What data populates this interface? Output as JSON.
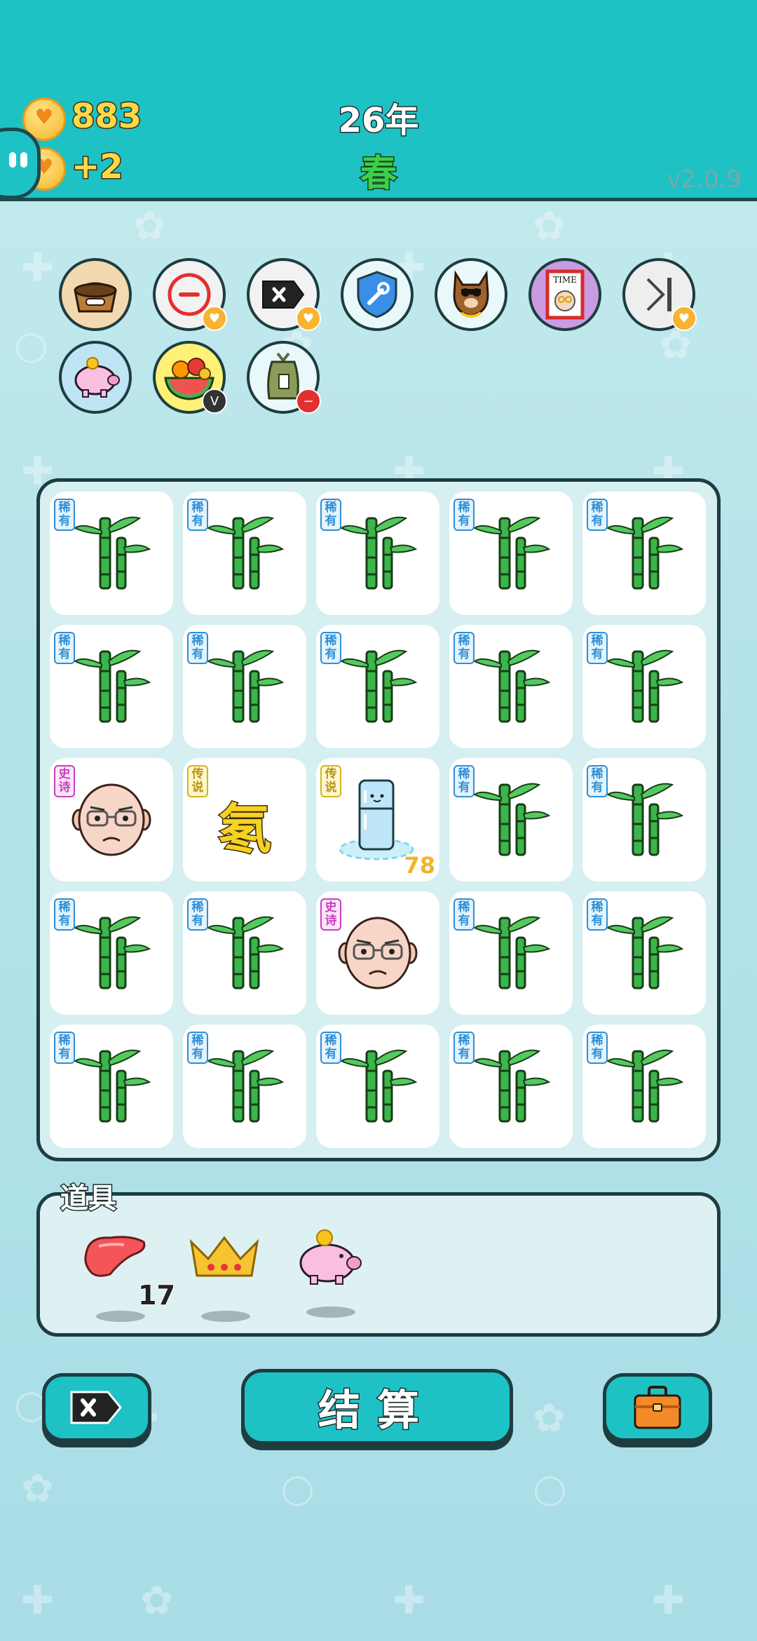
{
  "header": {
    "coins": "883",
    "income": "+2",
    "year": "26年",
    "season": "春",
    "version": "v2.0.9"
  },
  "relics": [
    {
      "icon": "pet-food-bowl-icon"
    },
    {
      "icon": "remove-minus-icon"
    },
    {
      "icon": "delete-tag-icon"
    },
    {
      "icon": "shield-wrench-icon"
    },
    {
      "icon": "cool-dog-icon"
    },
    {
      "icon": "time-magazine-icon"
    },
    {
      "icon": "skip-forward-icon"
    },
    {
      "icon": "piggy-bank-icon"
    },
    {
      "icon": "fruit-basket-icon"
    },
    {
      "icon": "trash-bag-icon"
    }
  ],
  "tags": {
    "rare": "稀有",
    "epic": "史诗",
    "legend": "传说"
  },
  "board": {
    "rows": [
      [
        "bamboo",
        "bamboo",
        "bamboo",
        "bamboo",
        "bamboo"
      ],
      [
        "bamboo",
        "bamboo",
        "bamboo",
        "bamboo",
        "bamboo"
      ],
      [
        "old-man",
        "radon",
        "fridge",
        "bamboo",
        "bamboo"
      ],
      [
        "bamboo",
        "bamboo",
        "old-man",
        "bamboo",
        "bamboo"
      ],
      [
        "bamboo",
        "bamboo",
        "bamboo",
        "bamboo",
        "bamboo"
      ]
    ],
    "radon_char": "氡",
    "fridge_count": "78"
  },
  "items_panel": {
    "title": "道具",
    "items": [
      {
        "icon": "liver-icon",
        "count": "17"
      },
      {
        "icon": "crown-icon"
      },
      {
        "icon": "piggy-bank-icon"
      }
    ]
  },
  "buttons": {
    "settle": "结算",
    "remove_icon": "delete-tag-icon",
    "bag_icon": "briefcase-icon"
  },
  "colors": {
    "teal": "#1ec2c5",
    "outline": "#1d3d40",
    "rare": "#2f8fd6",
    "epic": "#c93fc0",
    "legend": "#d9b11d"
  }
}
